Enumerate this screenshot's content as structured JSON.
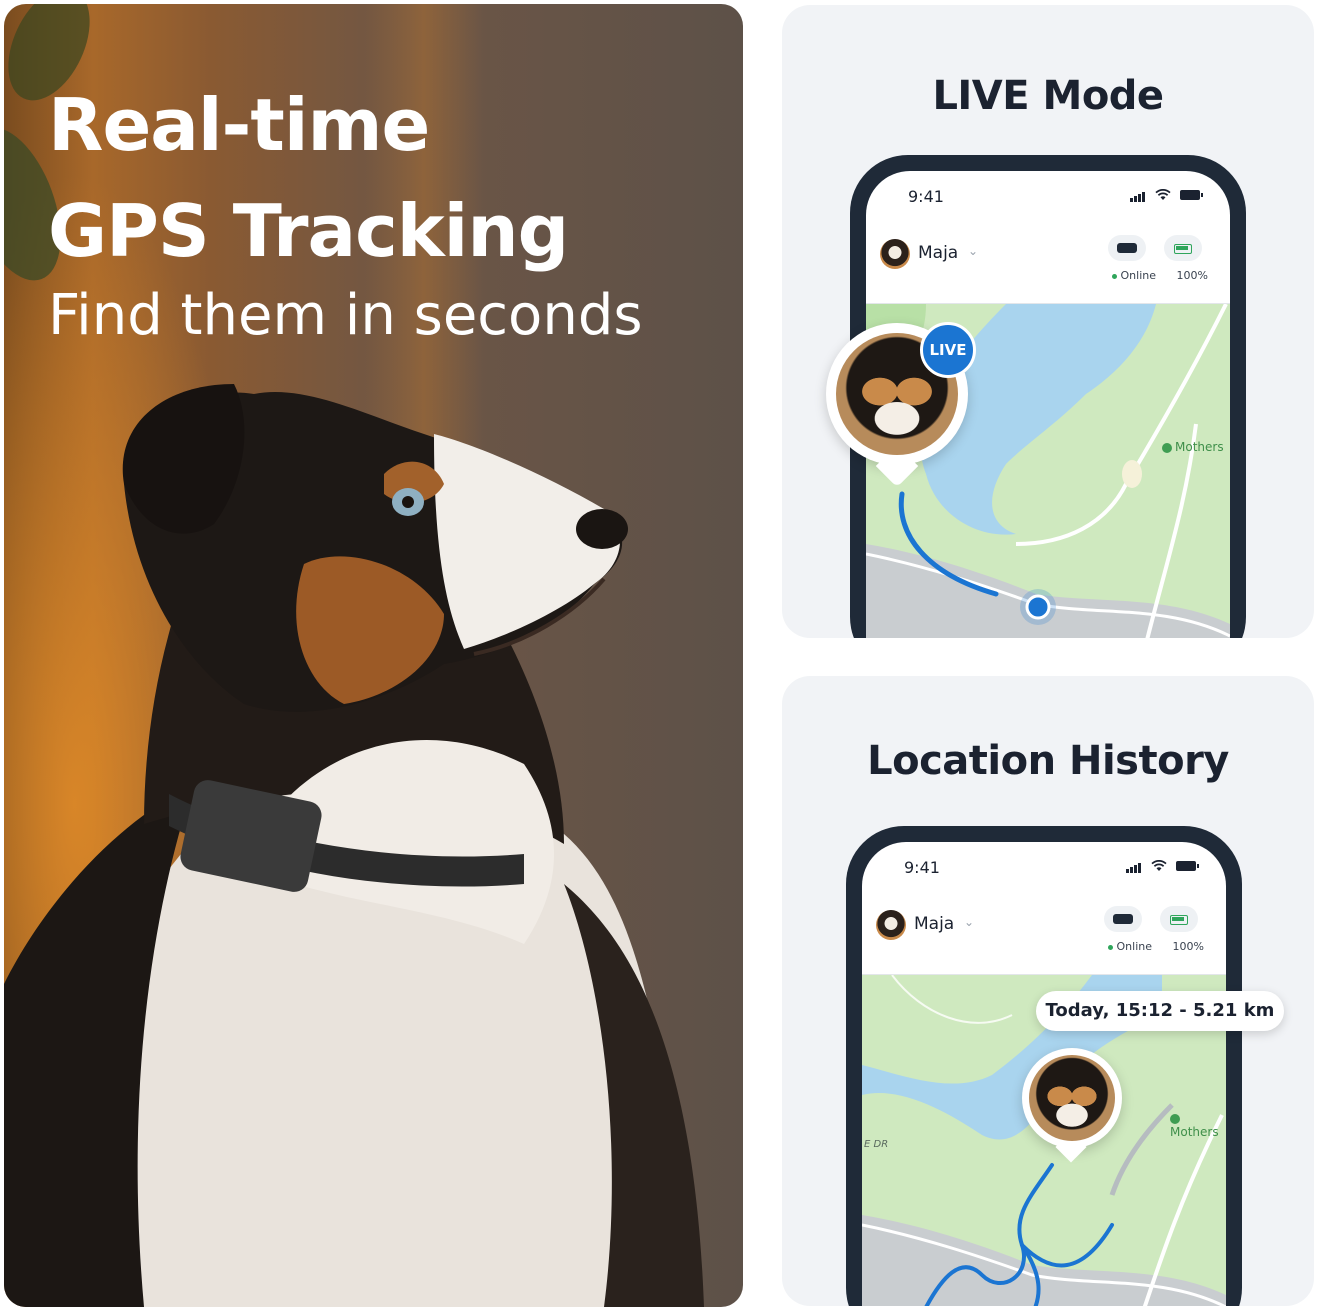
{
  "hero": {
    "title_line1": "Real-time",
    "title_line2": "GPS Tracking",
    "subtitle": "Find them in seconds"
  },
  "cards": [
    {
      "title": "LIVE Mode",
      "status_time": "9:41",
      "pet_name": "Maja",
      "device_status": "Online",
      "battery": "100%",
      "live_badge": "LIVE",
      "map_label": "Mothers"
    },
    {
      "title": "Location History",
      "status_time": "9:41",
      "pet_name": "Maja",
      "device_status": "Online",
      "battery": "100%",
      "history_bubble": "Today, 15:12 - 5.21 km",
      "map_label": "Mothers",
      "road_label": "E DR"
    }
  ],
  "colors": {
    "brand_blue": "#1b75d2",
    "map_green": "#cfe9bf",
    "water": "#a9d4ee",
    "online_green": "#2fa55b",
    "card_bg": "#f1f3f6",
    "phone_frame": "#1f2a38"
  }
}
